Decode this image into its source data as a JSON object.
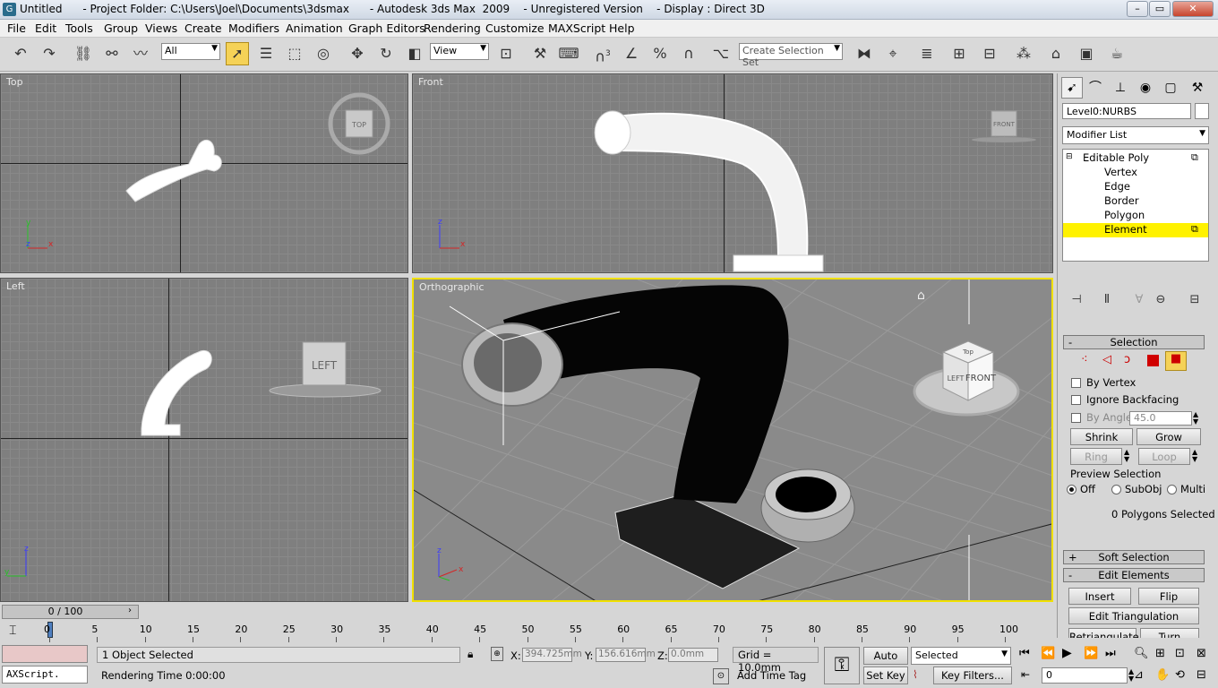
{
  "window": {
    "title": "Untitled      - Project Folder: C:\\Users\\Joel\\Documents\\3dsmax      - Autodesk 3ds Max  2009    - Unregistered Version    - Display : Direct 3D",
    "min_glyph": "–",
    "max_glyph": "▭",
    "close_glyph": "✕",
    "icon_glyph": "G"
  },
  "menu": [
    "File",
    "Edit",
    "Tools",
    "Group",
    "Views",
    "Create",
    "Modifiers",
    "Animation",
    "Graph Editors",
    "Rendering",
    "Customize",
    "MAXScript",
    "Help"
  ],
  "toolbar": {
    "filter_value": "All",
    "refcoord_value": "View",
    "selection_set_placeholder": "Create Selection Set",
    "snap_label": "3"
  },
  "viewports": {
    "top": "Top",
    "front": "Front",
    "left": "Left",
    "ortho": "Orthographic",
    "viewcube_top": "TOP",
    "viewcube_front": "FRONT",
    "viewcube_left": "LEFT",
    "viewcube_front_big": "FRONT",
    "viewcube_left_big": "LEFT",
    "viewcube_top_big": "Top",
    "axis_x": "x",
    "axis_y": "y",
    "axis_z": "z"
  },
  "command_panel": {
    "object_name": "Level0:NURBS",
    "modifier_list": "Modifier List",
    "stack": [
      {
        "label": "Editable Poly",
        "level": 0,
        "selected": false
      },
      {
        "label": "Vertex",
        "level": 1,
        "selected": false
      },
      {
        "label": "Edge",
        "level": 1,
        "selected": false
      },
      {
        "label": "Border",
        "level": 1,
        "selected": false
      },
      {
        "label": "Polygon",
        "level": 1,
        "selected": false
      },
      {
        "label": "Element",
        "level": 1,
        "selected": true
      }
    ],
    "selection_title": "Selection",
    "by_vertex": "By Vertex",
    "ignore_backfacing": "Ignore Backfacing",
    "by_angle": "By Angle:",
    "angle_value": "45.0",
    "shrink": "Shrink",
    "grow": "Grow",
    "ring": "Ring",
    "loop": "Loop",
    "preview_selection": "Preview Selection",
    "preview_options": [
      "Off",
      "SubObj",
      "Multi"
    ],
    "polygons_selected": "0 Polygons Selected",
    "soft_selection": "Soft Selection",
    "edit_elements": "Edit Elements",
    "insert_vertex": "Insert Vertex",
    "flip": "Flip",
    "edit_triangulation": "Edit Triangulation",
    "retriangulate": "Retriangulate",
    "turn": "Turn"
  },
  "timeline": {
    "frame_counter": "0 / 100",
    "ticks": [
      "0",
      "5",
      "10",
      "15",
      "20",
      "25",
      "30",
      "35",
      "40",
      "45",
      "50",
      "55",
      "60",
      "65",
      "70",
      "75",
      "80",
      "85",
      "90",
      "95",
      "100"
    ]
  },
  "status": {
    "maxscript": "AXScript.",
    "objects_selected": "1 Object Selected",
    "rendering_time": "Rendering Time  0:00:00",
    "x_label": "X:",
    "x_value": "394.725mm",
    "y_label": "Y:",
    "y_value": "156.616mm",
    "z_label": "Z:",
    "z_value": "0.0mm",
    "grid": "Grid = 10.0mm",
    "add_time_tag": "Add Time Tag",
    "auto_key": "Auto Key",
    "set_key": "Set Key",
    "key_mode_value": "Selected",
    "key_filters": "Key Filters...",
    "current_frame": "0"
  }
}
